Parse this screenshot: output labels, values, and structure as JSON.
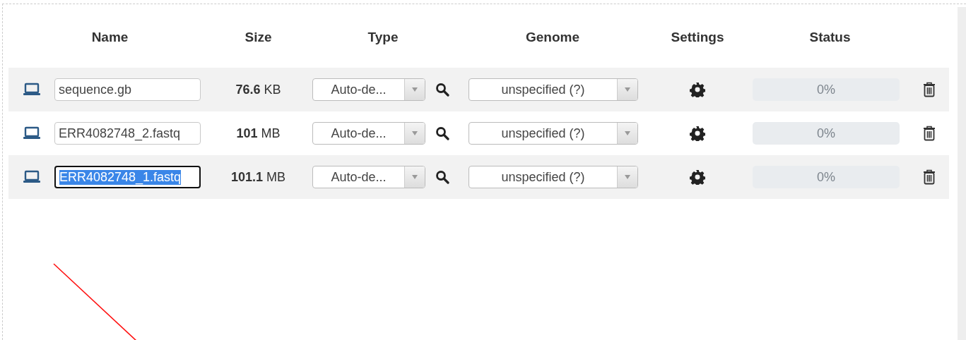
{
  "columns": [
    "Name",
    "Size",
    "Type",
    "Genome",
    "Settings",
    "Status"
  ],
  "rows": [
    {
      "name": "sequence.gb",
      "focused": false,
      "size": "**76.6** KB",
      "type": "Auto-de...",
      "genome": "unspecified (?)",
      "status": {
        "level": 0,
        "reading": "0%"
      }
    },
    {
      "name": "ERR4082748_2.fastq",
      "focused": false,
      "size": "**101** MB",
      "type": "Auto-de...",
      "genome": "unspecified (?)",
      "status": {
        "level": 0,
        "reading": "0%"
      }
    },
    {
      "name": "ERR4082748_1.fastq",
      "focused": true,
      "size": "**101.1** MB",
      "type": "Auto-de...",
      "genome": "unspecified (?)",
      "status": {
        "level": 0,
        "reading": "0%"
      }
    }
  ]
}
